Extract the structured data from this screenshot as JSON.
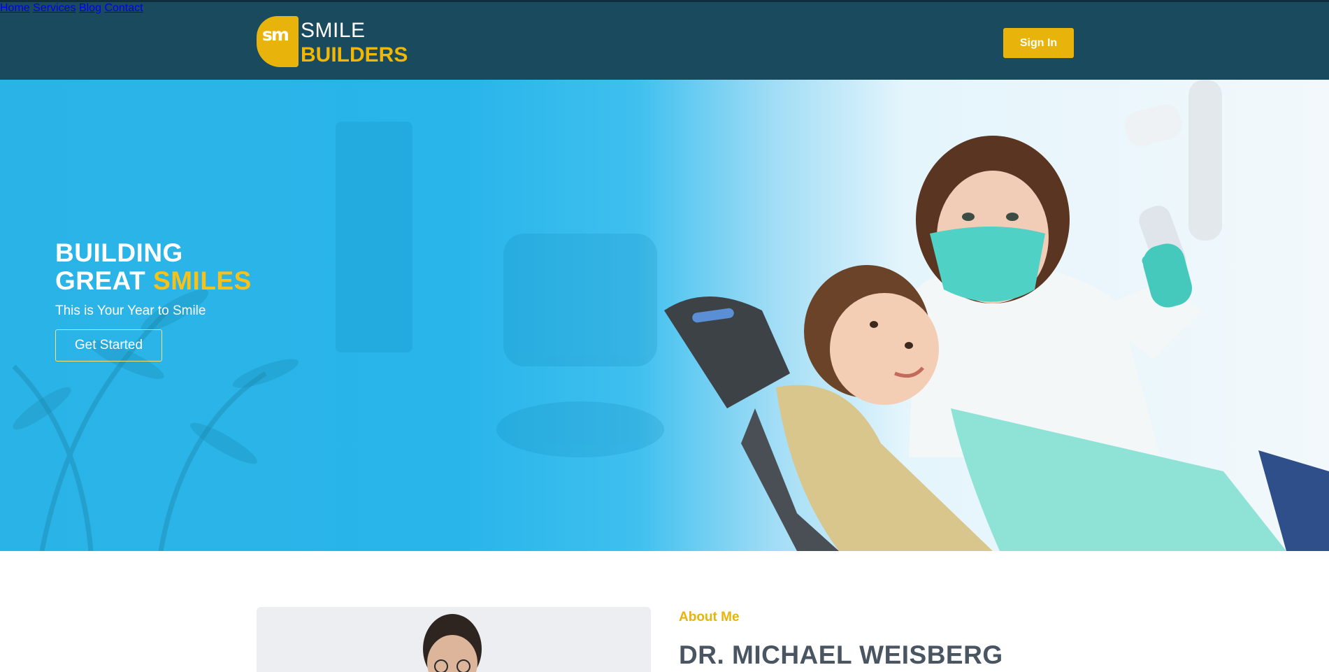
{
  "header": {
    "logo": {
      "badge": "sm",
      "line1": "SMILE",
      "line2": "BUILDERS"
    },
    "nav": [
      {
        "label": "Home"
      },
      {
        "label": "Services"
      },
      {
        "label": "Blog"
      },
      {
        "label": "Contact"
      }
    ],
    "signin_label": "Sign In",
    "colors": {
      "bar": "#1a4a5e",
      "accent": "#e8b40c"
    }
  },
  "hero": {
    "title_line1": "BUILDING",
    "title_line2_plain": "GREAT",
    "title_line2_highlight": "SMILES",
    "subtitle": "This is Your Year to Smile",
    "cta_label": "Get Started",
    "colors": {
      "background": "#29b5ea",
      "highlight": "#f6c21a"
    }
  },
  "about": {
    "kicker": "About Me",
    "name": "DR. MICHAEL WEISBERG"
  }
}
